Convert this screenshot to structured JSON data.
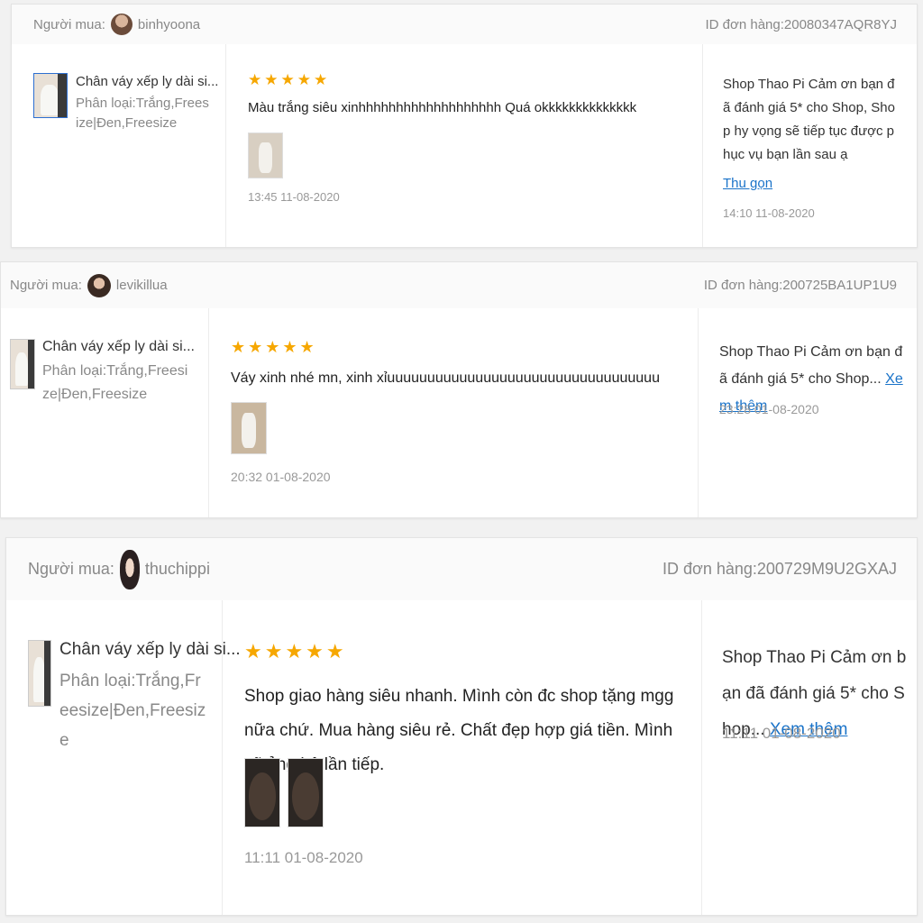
{
  "reviews": [
    {
      "buyer_label": "Người mua:",
      "buyer_name": "binhyoona",
      "order_id": "ID đơn hàng:20080347AQR8YJ",
      "product_name": "Chân váy xếp ly dài si...",
      "variant": "Phân loại:Trắng,Freesize|Đen,Freesize",
      "stars": "★★★★★",
      "review_text": "Màu trắng siêu xinhhhhhhhhhhhhhhhhhhh Quá okkkkkkkkkkkkkk",
      "review_time": "13:45 11-08-2020",
      "reply_text": "Shop Thao Pi Cảm ơn bạn đã đánh giá 5* cho Shop, Shop hy vọng sẽ tiếp tục được phục vụ bạn lần sau ạ",
      "reply_link": "Thu gọn",
      "reply_time": "14:10 11-08-2020"
    },
    {
      "buyer_label": "Người mua:",
      "buyer_name": "levikillua",
      "order_id": "ID đơn hàng:200725BA1UP1U9",
      "product_name": "Chân váy xếp ly dài si...",
      "variant": "Phân loại:Trắng,Freesize|Đen,Freesize",
      "stars": "★★★★★",
      "review_text": "Váy xinh nhé mn, xinh xỉuuuuuuuuuuuuuuuuuuuuuuuuuuuuuuuuuu",
      "review_time": "20:32 01-08-2020",
      "reply_text": "Shop Thao Pi Cảm ơn bạn đã đánh giá 5* cho Shop...",
      "reply_link": "Xem thêm",
      "reply_time": "23:28 01-08-2020"
    },
    {
      "buyer_label": "Người mua:",
      "buyer_name": "thuchippi",
      "order_id": "ID đơn hàng:200729M9U2GXAJ",
      "product_name": "Chân váy xếp ly dài si...",
      "variant": "Phân loại:Trắng,Freesize|Đen,Freesize",
      "stars": "★★★★★",
      "review_text": "Shop giao hàng siêu nhanh. Mình còn đc shop tặng mgg nữa chứ. Mua hàng siêu rẻ. Chất đẹp hợp giá tiền. Mình sẽ ủng hộ lần tiếp.",
      "review_time": "11:11 01-08-2020",
      "reply_text": "Shop Thao Pi Cảm ơn bạn đã đánh giá 5* cho Shop...",
      "reply_link": "Xem thêm",
      "reply_time": "11:11 01-08-2020"
    }
  ],
  "colors": {
    "star": "#f6a700",
    "link": "#1a73c9",
    "muted": "#888888"
  }
}
